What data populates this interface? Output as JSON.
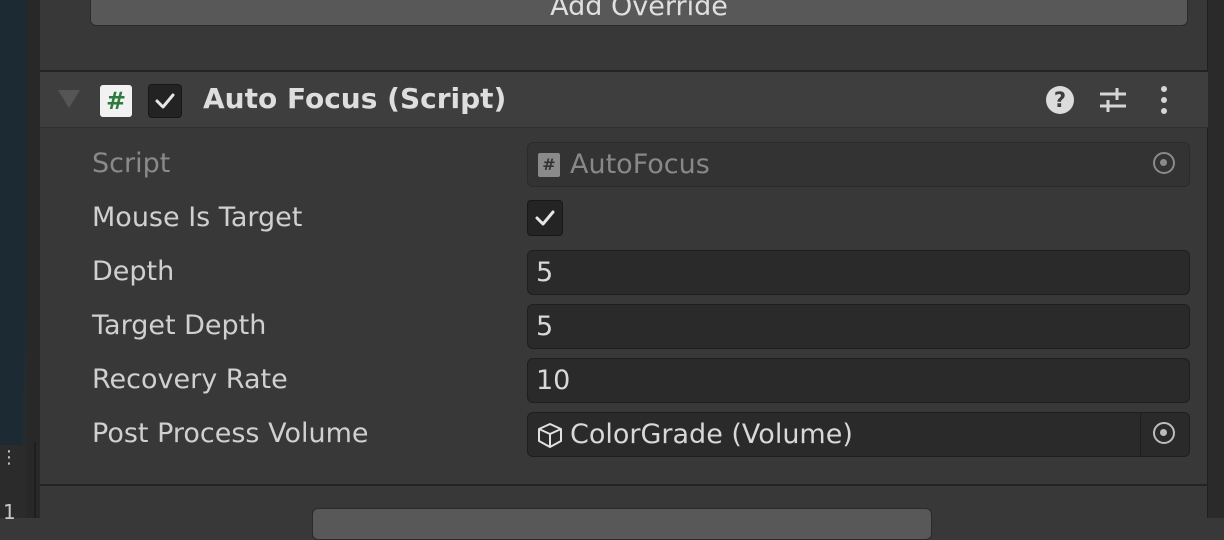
{
  "toolbar": {
    "add_override_label": "Add Override"
  },
  "component": {
    "title": "Auto Focus (Script)",
    "enabled": true,
    "script_icon_glyph": "#",
    "help_glyph": "?"
  },
  "properties": {
    "script": {
      "label": "Script",
      "value": "AutoFocus",
      "icon": "script-hash-icon"
    },
    "mouse_is_target": {
      "label": "Mouse Is Target",
      "checked": true
    },
    "depth": {
      "label": "Depth",
      "value": "5"
    },
    "target_depth": {
      "label": "Target Depth",
      "value": "5"
    },
    "recovery_rate": {
      "label": "Recovery Rate",
      "value": "10"
    },
    "post_process_volume": {
      "label": "Post Process Volume",
      "value": "ColorGrade (Volume)",
      "icon": "cube-icon"
    }
  },
  "left_panel": {
    "page_number": "1",
    "dots": "⋮"
  },
  "colors": {
    "background": "#383838",
    "header": "#3e3e3e",
    "field": "#2a2a2a",
    "script_icon_green": "#2f7a3d"
  }
}
